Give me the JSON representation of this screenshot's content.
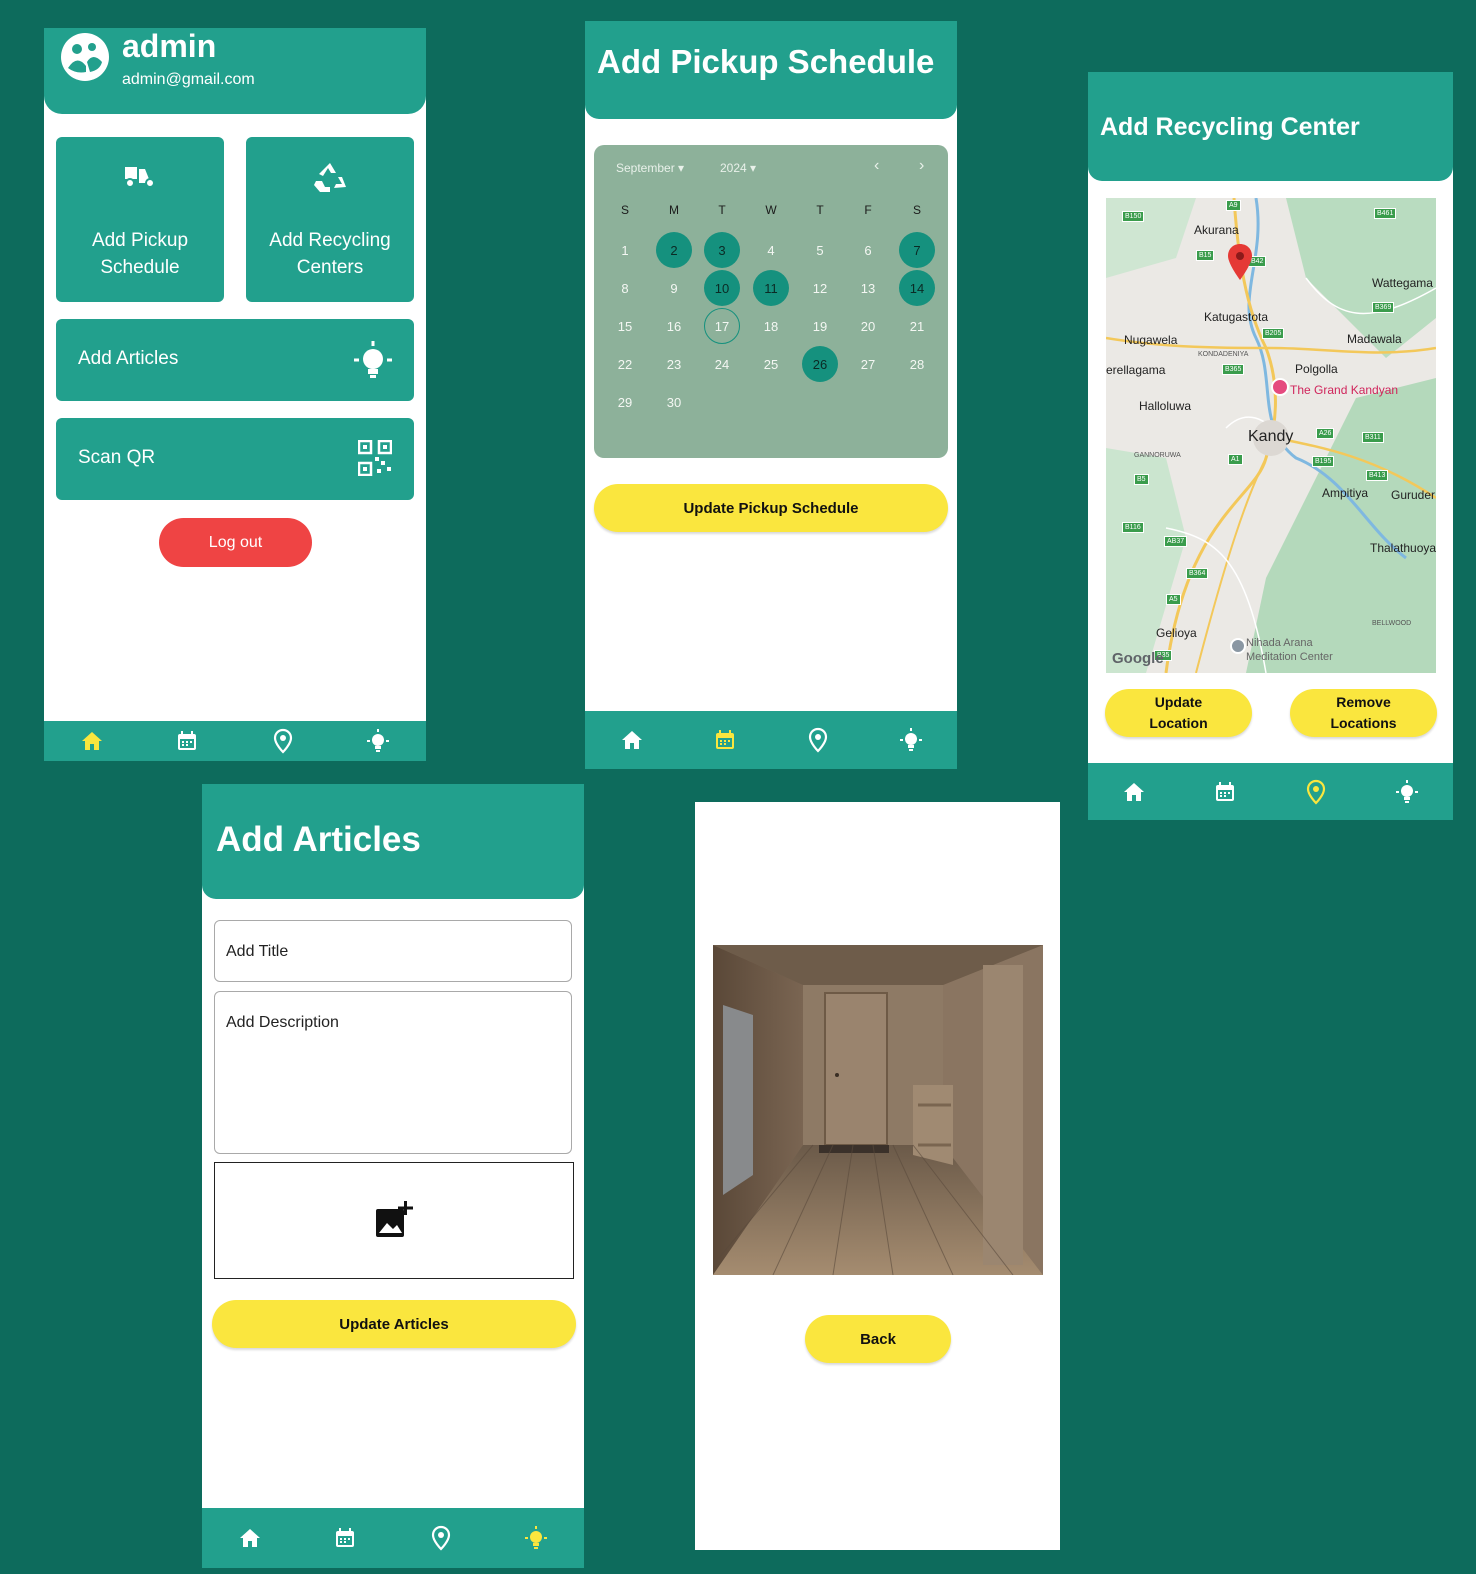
{
  "colors": {
    "background": "#0d6b5c",
    "teal": "#22a08d",
    "yellow": "#fae63e",
    "logout": "#ef4444",
    "calendar": "#8db19a",
    "selected_day": "#15917e"
  },
  "nav_icons": [
    "home-icon",
    "calendar-icon",
    "location-pin-icon",
    "lightbulb-icon"
  ],
  "dashboard": {
    "user_name": "admin",
    "user_email": "admin@gmail.com",
    "tiles": {
      "pickup": "Add Pickup\nSchedule",
      "recycling": "Add Recycling\nCenters",
      "articles": "Add Articles",
      "scan": "Scan QR"
    },
    "logout_label": "Log out",
    "active_nav": "home"
  },
  "pickup_schedule": {
    "title": "Add Pickup Schedule",
    "calendar": {
      "month": "September",
      "year": "2024",
      "weekdays": [
        "S",
        "M",
        "T",
        "W",
        "T",
        "F",
        "S"
      ],
      "first_day_offset": 0,
      "days_in_month": 30,
      "selected_days": [
        2,
        3,
        7,
        10,
        11,
        14,
        26
      ],
      "today": 17
    },
    "update_label": "Update Pickup Schedule",
    "active_nav": "calendar"
  },
  "recycling_center": {
    "title": "Add Recycling Center",
    "map": {
      "places": [
        "Akurana",
        "Wattegama",
        "Katugastota",
        "Nugawela",
        "Madawala",
        "KONDADENIYA",
        "Polgolla",
        "erellagama",
        "The Grand Kandyan",
        "Halloluwa",
        "Kandy",
        "GANNORUWA",
        "Ampitiya",
        "Guruder",
        "Thalathuoya",
        "BELLWOOD",
        "Gelioya",
        "Nihada Arana\nMeditation Center"
      ],
      "road_badges": [
        "B150",
        "A9",
        "B461",
        "B15",
        "B42",
        "B369",
        "B205",
        "B365",
        "A26",
        "B311",
        "A1",
        "B195",
        "B413",
        "B5",
        "B116",
        "AB37",
        "B364",
        "A5",
        "B35"
      ],
      "attribution": "Google"
    },
    "update_label": "Update\nLocation",
    "remove_label": "Remove\nLocations",
    "active_nav": "location"
  },
  "articles": {
    "title": "Add Articles",
    "title_placeholder": "Add Title",
    "description_placeholder": "Add Description",
    "image_icon": "add-photo-icon",
    "update_label": "Update Articles",
    "active_nav": "articles"
  },
  "image_preview": {
    "image_description": "wooden room interior with door, fridge and bench",
    "back_label": "Back"
  }
}
